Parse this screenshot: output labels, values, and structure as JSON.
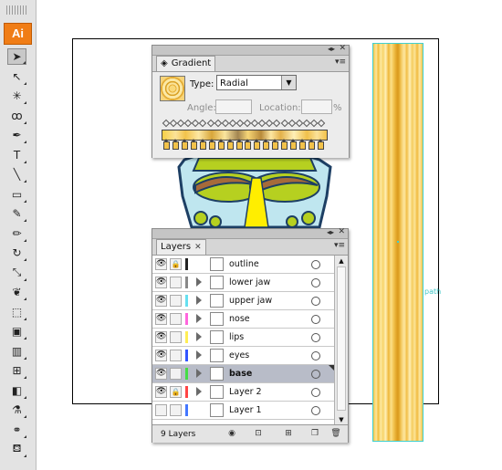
{
  "app": {
    "logo": "Ai",
    "accent": "#f07d16"
  },
  "tools": [
    {
      "name": "selection-tool",
      "glyph": "➤",
      "active": true
    },
    {
      "name": "direct-selection-tool",
      "glyph": "↖"
    },
    {
      "name": "magic-wand-tool",
      "glyph": "✳"
    },
    {
      "name": "lasso-tool",
      "glyph": "ꝏ"
    },
    {
      "name": "pen-tool",
      "glyph": "✒"
    },
    {
      "name": "type-tool",
      "glyph": "T"
    },
    {
      "name": "line-tool",
      "glyph": "╲"
    },
    {
      "name": "rectangle-tool",
      "glyph": "▭"
    },
    {
      "name": "paintbrush-tool",
      "glyph": "✎"
    },
    {
      "name": "pencil-tool",
      "glyph": "✏"
    },
    {
      "name": "rotate-tool",
      "glyph": "↻"
    },
    {
      "name": "scale-tool",
      "glyph": "⤡"
    },
    {
      "name": "warp-tool",
      "glyph": "❦"
    },
    {
      "name": "free-transform-tool",
      "glyph": "⬚"
    },
    {
      "name": "symbol-sprayer-tool",
      "glyph": "▣"
    },
    {
      "name": "graph-tool",
      "glyph": "▥"
    },
    {
      "name": "mesh-tool",
      "glyph": "⊞"
    },
    {
      "name": "gradient-tool",
      "glyph": "◧"
    },
    {
      "name": "eyedropper-tool",
      "glyph": "⚗"
    },
    {
      "name": "blend-tool",
      "glyph": "⚭"
    },
    {
      "name": "live-paint-bucket-tool",
      "glyph": "⛾"
    }
  ],
  "gradient": {
    "tab": "Gradient",
    "type_label": "Type:",
    "type_value": "Radial",
    "angle_label": "Angle:",
    "location_label": "Location:",
    "percent": "%"
  },
  "layers": {
    "tab": "Layers",
    "count": "9 Layers",
    "items": [
      {
        "name": "outline",
        "color": "#222222",
        "locked": true,
        "visible": true,
        "expand": false,
        "selected": false
      },
      {
        "name": "lower jaw",
        "color": "#888888",
        "locked": false,
        "visible": true,
        "expand": true,
        "selected": false
      },
      {
        "name": "upper jaw",
        "color": "#66e0f0",
        "locked": false,
        "visible": true,
        "expand": true,
        "selected": false
      },
      {
        "name": "nose",
        "color": "#ff66dd",
        "locked": false,
        "visible": true,
        "expand": true,
        "selected": false
      },
      {
        "name": "lips",
        "color": "#ffee55",
        "locked": false,
        "visible": true,
        "expand": true,
        "selected": false
      },
      {
        "name": "eyes",
        "color": "#3355ff",
        "locked": false,
        "visible": true,
        "expand": true,
        "selected": false
      },
      {
        "name": "base",
        "color": "#44dd44",
        "locked": false,
        "visible": true,
        "expand": true,
        "selected": true
      },
      {
        "name": "Layer 2",
        "color": "#ff4444",
        "locked": true,
        "visible": true,
        "expand": true,
        "selected": false
      },
      {
        "name": "Layer 1",
        "color": "#4477ff",
        "locked": false,
        "visible": false,
        "expand": false,
        "selected": false
      }
    ]
  },
  "canvas": {
    "path_label": "path"
  }
}
